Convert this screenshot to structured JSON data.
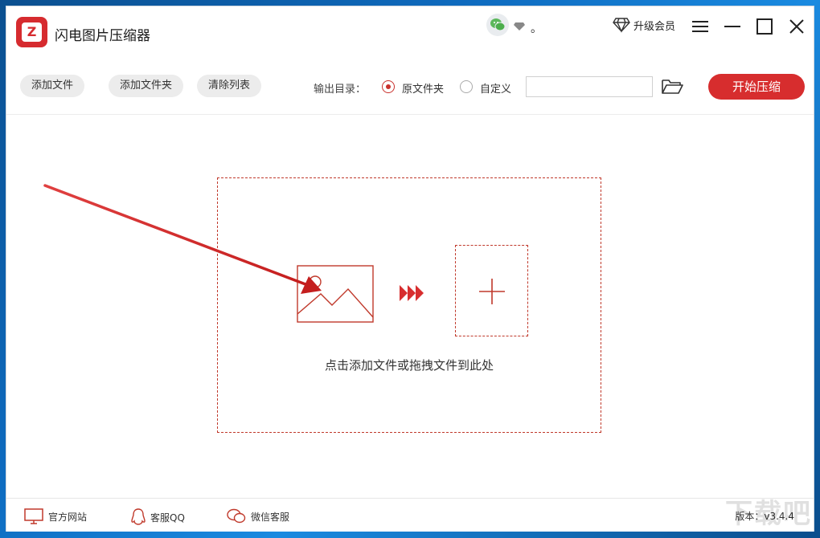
{
  "titlebar": {
    "app_title": "闪电图片压缩器",
    "user_name": "。",
    "upgrade_label": "升级会员"
  },
  "toolbar": {
    "add_file": "添加文件",
    "add_folder": "添加文件夹",
    "clear_list": "清除列表",
    "output_label": "输出目录：",
    "radio_original": "原文件夹",
    "radio_custom": "自定义",
    "path_value": "",
    "start_label": "开始压缩"
  },
  "dropzone": {
    "hint": "点击添加文件或拖拽文件到此处"
  },
  "footer": {
    "website": "官方网站",
    "qq_service": "客服QQ",
    "wechat_service": "微信客服",
    "version": "版本：v3.4.4"
  },
  "watermark": {
    "main": "下载吧"
  },
  "colors": {
    "accent_red": "#d72d2e",
    "dashed_red": "#c0392b"
  },
  "icons": [
    "app-logo-icon",
    "wechat-icon",
    "diamond-icon",
    "menu-icon",
    "minimize-icon",
    "maximize-icon",
    "close-icon",
    "folder-open-icon",
    "image-icon",
    "triple-arrow-icon",
    "plus-icon",
    "monitor-icon",
    "qq-icon",
    "wechat-service-icon"
  ]
}
